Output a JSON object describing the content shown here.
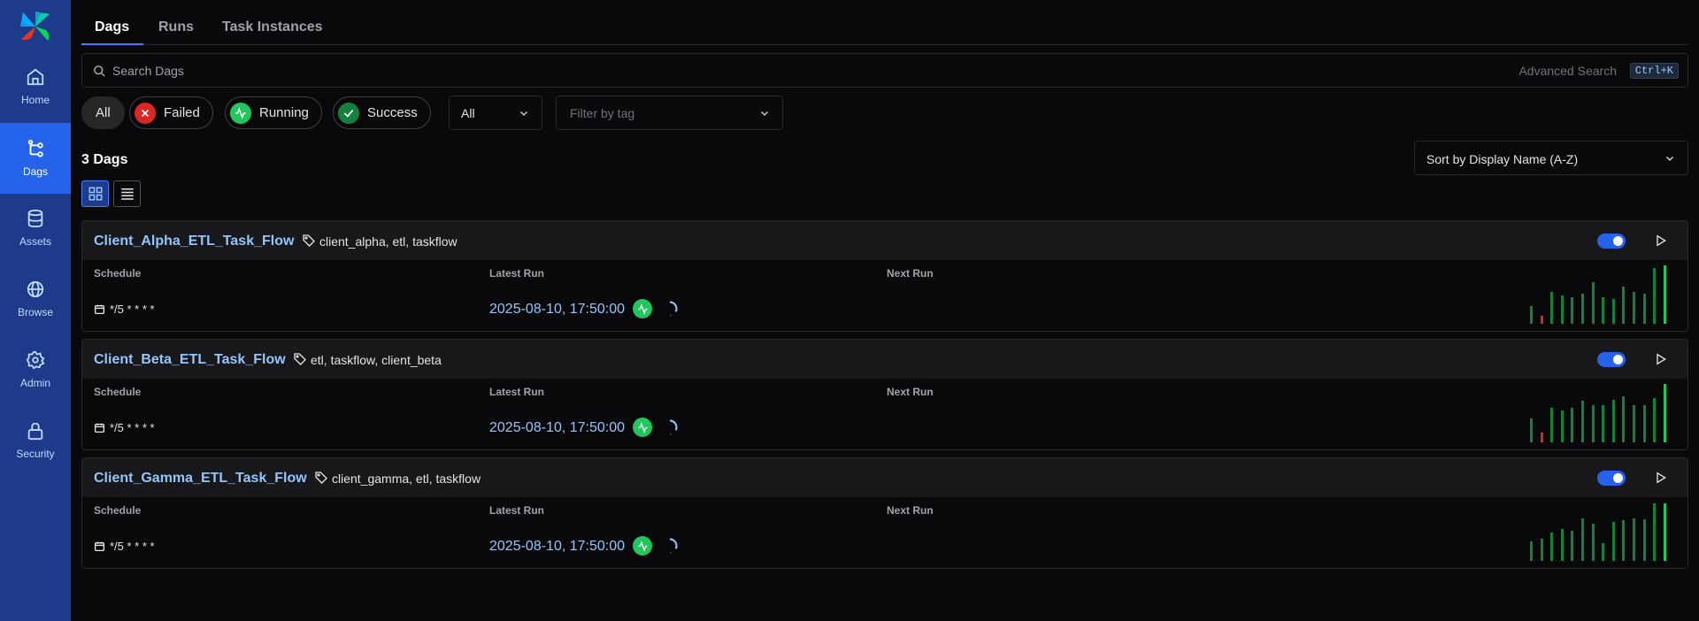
{
  "sidebar": {
    "logo": "airflow-pinwheel-logo",
    "items": [
      {
        "label": "Home",
        "icon": "home-icon"
      },
      {
        "label": "Dags",
        "icon": "dags-icon",
        "active": true
      },
      {
        "label": "Assets",
        "icon": "database-icon"
      },
      {
        "label": "Browse",
        "icon": "globe-icon"
      },
      {
        "label": "Admin",
        "icon": "gear-icon"
      },
      {
        "label": "Security",
        "icon": "lock-icon"
      }
    ]
  },
  "tabs": [
    {
      "label": "Dags",
      "active": true
    },
    {
      "label": "Runs"
    },
    {
      "label": "Task Instances"
    }
  ],
  "search": {
    "placeholder": "Search Dags",
    "value": "",
    "advanced_label": "Advanced Search",
    "shortcut": "Ctrl+K"
  },
  "filters": {
    "all_label": "All",
    "failed_label": "Failed",
    "running_label": "Running",
    "success_label": "Success",
    "paused_select_value": "All",
    "tag_placeholder": "Filter by tag"
  },
  "colors": {
    "failed": "#dc2626",
    "running": "#22c55e",
    "success": "#15803d",
    "accent": "#2563eb",
    "link": "#93c5fd"
  },
  "dag_count_label": "3 Dags",
  "sort_label": "Sort by Display Name (A-Z)",
  "column_labels": {
    "schedule": "Schedule",
    "latest_run": "Latest Run",
    "next_run": "Next Run"
  },
  "dags": [
    {
      "name": "Client_Alpha_ETL_Task_Flow",
      "tags": "client_alpha, etl, taskflow",
      "schedule": "*/5 * * * *",
      "latest_run": "2025-08-10, 17:50:00",
      "enabled": true,
      "run_bars": [
        {
          "value": 0.3,
          "state": "success"
        },
        {
          "value": 0.14,
          "state": "failed"
        },
        {
          "value": 0.55,
          "state": "success"
        },
        {
          "value": 0.48,
          "state": "success"
        },
        {
          "value": 0.45,
          "state": "success"
        },
        {
          "value": 0.52,
          "state": "success"
        },
        {
          "value": 0.71,
          "state": "success"
        },
        {
          "value": 0.45,
          "state": "success"
        },
        {
          "value": 0.43,
          "state": "success"
        },
        {
          "value": 0.64,
          "state": "success"
        },
        {
          "value": 0.54,
          "state": "success"
        },
        {
          "value": 0.52,
          "state": "success"
        },
        {
          "value": 0.95,
          "state": "success"
        },
        {
          "value": 1.0,
          "state": "running"
        }
      ]
    },
    {
      "name": "Client_Beta_ETL_Task_Flow",
      "tags": "etl, taskflow, client_beta",
      "schedule": "*/5 * * * *",
      "latest_run": "2025-08-10, 17:50:00",
      "enabled": true,
      "run_bars": [
        {
          "value": 0.41,
          "state": "success"
        },
        {
          "value": 0.16,
          "state": "failed"
        },
        {
          "value": 0.59,
          "state": "success"
        },
        {
          "value": 0.55,
          "state": "success"
        },
        {
          "value": 0.59,
          "state": "success"
        },
        {
          "value": 0.71,
          "state": "success"
        },
        {
          "value": 0.64,
          "state": "success"
        },
        {
          "value": 0.64,
          "state": "success"
        },
        {
          "value": 0.73,
          "state": "success"
        },
        {
          "value": 0.79,
          "state": "success"
        },
        {
          "value": 0.63,
          "state": "success"
        },
        {
          "value": 0.63,
          "state": "success"
        },
        {
          "value": 0.75,
          "state": "success"
        },
        {
          "value": 1.0,
          "state": "running"
        }
      ]
    },
    {
      "name": "Client_Gamma_ETL_Task_Flow",
      "tags": "client_gamma, etl, taskflow",
      "schedule": "*/5 * * * *",
      "latest_run": "2025-08-10, 17:50:00",
      "enabled": true,
      "run_bars": [
        {
          "value": 0.34,
          "state": "success"
        },
        {
          "value": 0.38,
          "state": "success"
        },
        {
          "value": 0.48,
          "state": "success"
        },
        {
          "value": 0.55,
          "state": "success"
        },
        {
          "value": 0.52,
          "state": "success"
        },
        {
          "value": 0.73,
          "state": "success"
        },
        {
          "value": 0.64,
          "state": "success"
        },
        {
          "value": 0.3,
          "state": "success"
        },
        {
          "value": 0.66,
          "state": "success"
        },
        {
          "value": 0.7,
          "state": "success"
        },
        {
          "value": 0.73,
          "state": "success"
        },
        {
          "value": 0.71,
          "state": "success"
        },
        {
          "value": 0.98,
          "state": "success"
        },
        {
          "value": 0.98,
          "state": "running"
        }
      ]
    }
  ]
}
